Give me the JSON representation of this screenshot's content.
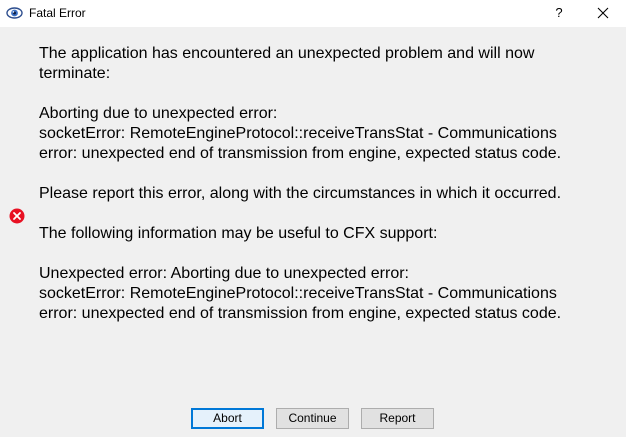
{
  "window": {
    "title": "Fatal Error",
    "help_label": "?",
    "icon": "eye-app-icon",
    "close_icon": "close-icon"
  },
  "message": {
    "line1": "The application has encountered an unexpected problem and will now\nterminate:",
    "line2": "Aborting due to unexpected error:\nsocketError: RemoteEngineProtocol::receiveTransStat - Communications\nerror: unexpected end of transmission from engine, expected status code.",
    "line3": "Please report this error, along with the circumstances in which it occurred.",
    "line4": "The following information may be useful to CFX support:",
    "line5": "Unexpected error: Aborting due to unexpected error:\nsocketError: RemoteEngineProtocol::receiveTransStat - Communications\nerror: unexpected end of transmission from engine, expected status code."
  },
  "status_icon": "error-icon",
  "buttons": {
    "abort": "Abort",
    "continue": "Continue",
    "report": "Report"
  },
  "colors": {
    "error_red": "#e81123",
    "focus_blue": "#0078d7"
  }
}
